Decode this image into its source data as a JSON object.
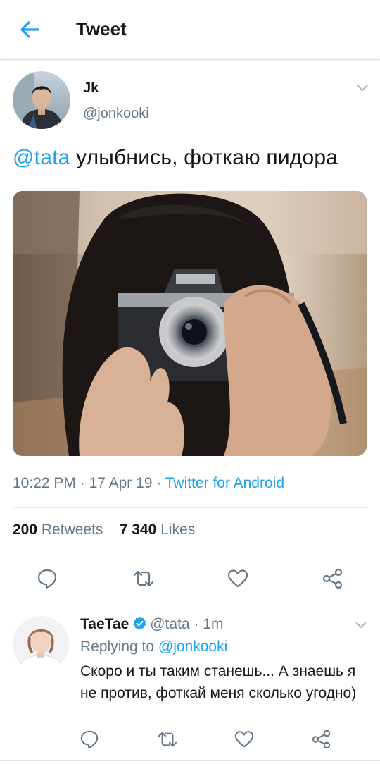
{
  "header": {
    "title": "Tweet",
    "back_icon": "arrow-left-icon"
  },
  "tweet": {
    "author_name": "Jk",
    "author_handle": "@jonkooki",
    "mention": "@tata",
    "text": " улыбнись, фоткаю пидора",
    "time": "10:22 PM",
    "date": "17 Apr 19",
    "source": "Twitter for Android",
    "retweets_count": "200",
    "retweets_label": "Retweets",
    "likes_count": "7 340",
    "likes_label": "Likes",
    "actions": [
      "reply-icon",
      "retweet-icon",
      "like-icon",
      "share-icon"
    ]
  },
  "reply": {
    "author_name": "TaeTae",
    "author_handle": "@tata",
    "time": "1m",
    "replying_label": "Replying to",
    "replying_to": "@jonkooki",
    "text": "Скоро и ты таким станешь... А знаешь я не против, фоткай меня сколько угодно)",
    "verified": true,
    "actions": [
      "reply-icon",
      "retweet-icon",
      "like-icon",
      "share-icon"
    ]
  },
  "colors": {
    "accent": "#1da1f2",
    "secondary_text": "#657786",
    "divider": "#e1e8ed"
  }
}
